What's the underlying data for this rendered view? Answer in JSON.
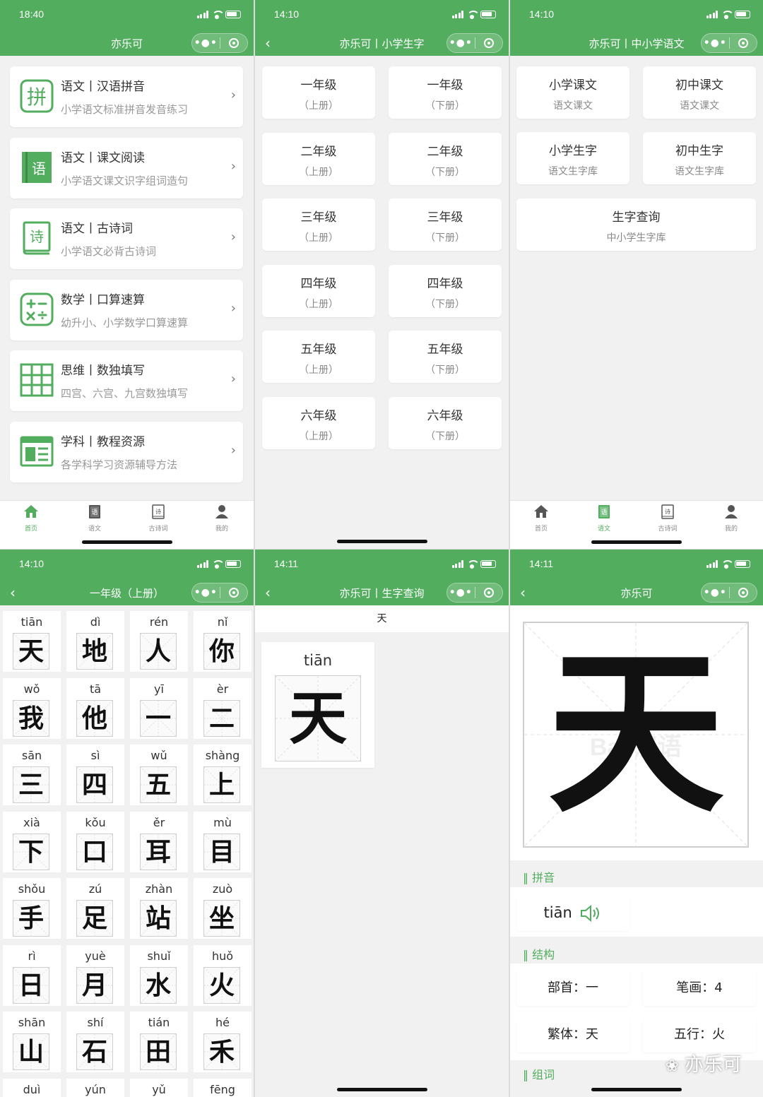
{
  "colors": {
    "accent": "#52ad5f",
    "bg": "#f1f1f1"
  },
  "p1": {
    "time": "18:40",
    "title": "亦乐可",
    "cards": [
      {
        "title": "语文丨汉语拼音",
        "sub": "小学语文标准拼音发音练习",
        "icon": "pinyin-icon",
        "glyph": "拼"
      },
      {
        "title": "语文丨课文阅读",
        "sub": "小学语文课文识字组词造句",
        "icon": "book-icon",
        "glyph": "语"
      },
      {
        "title": "语文丨古诗词",
        "sub": "小学语文必背古诗词",
        "icon": "poem-book-icon",
        "glyph": "诗"
      },
      {
        "title": "数学丨口算速算",
        "sub": "幼升小、小学数学口算速算",
        "icon": "calculator-icon",
        "glyph": ""
      },
      {
        "title": "思维丨数独填写",
        "sub": "四宫、六宫、九宫数独填写",
        "icon": "grid-icon",
        "glyph": ""
      },
      {
        "title": "学科丨教程资源",
        "sub": "各学科学习资源辅导方法",
        "icon": "layout-icon",
        "glyph": ""
      }
    ],
    "chevron": "›",
    "tabs": [
      {
        "label": "首页",
        "icon": "home-icon",
        "glyph": ""
      },
      {
        "label": "语文",
        "icon": "book-tab-icon",
        "glyph": "语"
      },
      {
        "label": "古诗词",
        "icon": "poem-tab-icon",
        "glyph": "诗"
      },
      {
        "label": "我的",
        "icon": "user-icon",
        "glyph": ""
      }
    ]
  },
  "p2": {
    "time": "14:10",
    "title": "亦乐可丨小学生字",
    "grades": [
      {
        "a": "一年级",
        "b": "（上册）"
      },
      {
        "a": "一年级",
        "b": "（下册）"
      },
      {
        "a": "二年级",
        "b": "（上册）"
      },
      {
        "a": "二年级",
        "b": "（下册）"
      },
      {
        "a": "三年级",
        "b": "（上册）"
      },
      {
        "a": "三年级",
        "b": "（下册）"
      },
      {
        "a": "四年级",
        "b": "（上册）"
      },
      {
        "a": "四年级",
        "b": "（下册）"
      },
      {
        "a": "五年级",
        "b": "（上册）"
      },
      {
        "a": "五年级",
        "b": "（下册）"
      },
      {
        "a": "六年级",
        "b": "（上册）"
      },
      {
        "a": "六年级",
        "b": "（下册）"
      }
    ]
  },
  "p3": {
    "time": "14:10",
    "title": "亦乐可丨中小学语文",
    "items": [
      {
        "a": "小学课文",
        "b": "语文课文"
      },
      {
        "a": "初中课文",
        "b": "语文课文"
      },
      {
        "a": "小学生字",
        "b": "语文生字库"
      },
      {
        "a": "初中生字",
        "b": "语文生字库"
      }
    ],
    "wide": {
      "a": "生字查询",
      "b": "中小学生字库"
    }
  },
  "p4": {
    "time": "14:10",
    "title": "一年级（上册）",
    "chars": [
      {
        "py": "tiān",
        "ch": "天"
      },
      {
        "py": "dì",
        "ch": "地"
      },
      {
        "py": "rén",
        "ch": "人"
      },
      {
        "py": "nǐ",
        "ch": "你"
      },
      {
        "py": "wǒ",
        "ch": "我"
      },
      {
        "py": "tā",
        "ch": "他"
      },
      {
        "py": "yī",
        "ch": "一"
      },
      {
        "py": "èr",
        "ch": "二"
      },
      {
        "py": "sān",
        "ch": "三"
      },
      {
        "py": "sì",
        "ch": "四"
      },
      {
        "py": "wǔ",
        "ch": "五"
      },
      {
        "py": "shàng",
        "ch": "上"
      },
      {
        "py": "xià",
        "ch": "下"
      },
      {
        "py": "kǒu",
        "ch": "口"
      },
      {
        "py": "ěr",
        "ch": "耳"
      },
      {
        "py": "mù",
        "ch": "目"
      },
      {
        "py": "shǒu",
        "ch": "手"
      },
      {
        "py": "zú",
        "ch": "足"
      },
      {
        "py": "zhàn",
        "ch": "站"
      },
      {
        "py": "zuò",
        "ch": "坐"
      },
      {
        "py": "rì",
        "ch": "日"
      },
      {
        "py": "yuè",
        "ch": "月"
      },
      {
        "py": "shuǐ",
        "ch": "水"
      },
      {
        "py": "huǒ",
        "ch": "火"
      },
      {
        "py": "shān",
        "ch": "山"
      },
      {
        "py": "shí",
        "ch": "石"
      },
      {
        "py": "tián",
        "ch": "田"
      },
      {
        "py": "hé",
        "ch": "禾"
      },
      {
        "py": "duì",
        "ch": ""
      },
      {
        "py": "yún",
        "ch": ""
      },
      {
        "py": "yǔ",
        "ch": ""
      },
      {
        "py": "fēng",
        "ch": ""
      }
    ]
  },
  "p5": {
    "time": "14:11",
    "title": "亦乐可丨生字查询",
    "query": "天",
    "result": {
      "py": "tiān",
      "ch": "天"
    }
  },
  "p6": {
    "time": "14:11",
    "title": "亦乐可",
    "big_char": "天",
    "watermark": "Bai 汉语",
    "sec_pinyin": "‖ 拼音",
    "pinyin": "tiān",
    "sec_struct": "‖ 结构",
    "radical": "部首：一",
    "strokes": "笔画：4",
    "trad": "繁体：天",
    "wuxing": "五行：火",
    "sec_words": "‖ 组词",
    "brand": "亦乐可"
  }
}
